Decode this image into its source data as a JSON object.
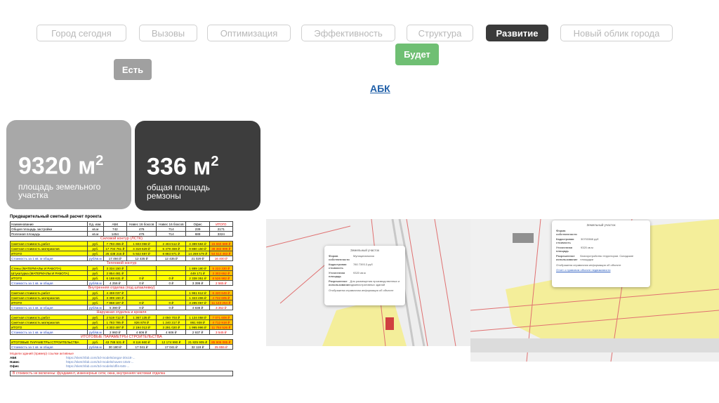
{
  "nav": [
    {
      "label": "Город сегодня"
    },
    {
      "label": "Вызовы"
    },
    {
      "label": "Оптимизация"
    },
    {
      "label": "Эффективность"
    },
    {
      "label": "Структура"
    },
    {
      "label": "Развитие",
      "active": true
    },
    {
      "label": "Новый облик города"
    }
  ],
  "tags": {
    "future": "Будет",
    "present": "Есть"
  },
  "link": "АБК",
  "cards": [
    {
      "value": "9320 м",
      "sup": "2",
      "label": "площадь земельного участка"
    },
    {
      "value": "336 м",
      "sup": "2",
      "label": "общая площадь ремзоны"
    }
  ],
  "sheet": {
    "title": "Предварительный сметный расчет проекта",
    "header": [
      "Наименование",
      "Ед. изм.",
      "АБК",
      "Навес 16 боксов",
      "Навес 16 боксов",
      "Офис",
      "ИТОГО"
    ],
    "rows": [
      {
        "c": [
          "Общая площадь застройки",
          "кв.м",
          "742",
          "476",
          "714",
          "239",
          "2171"
        ]
      },
      {
        "c": [
          "Полезная площадь",
          "кв.м",
          "1454",
          "476",
          "714",
          "688",
          "3324"
        ]
      },
      {
        "sec": "Силовой контур (ЛСТК)"
      },
      {
        "t": "y",
        "c": [
          "Сметная стоимость работ",
          "руб.",
          "7 793 455 ₽",
          "1 603 068 ₽",
          "2 404 512 ₽",
          "4 389 584 ₽",
          "15 660 589 ₽"
        ]
      },
      {
        "t": "y",
        "c": [
          "Сметная стоимость материалов",
          "руб.",
          "17 704 761 ₽",
          "4 319 629 ₽",
          "6 479 459 ₽",
          "9 880 150 ₽",
          "38 383 999 ₽"
        ]
      },
      {
        "t": "y",
        "c": [
          "ИТОГО",
          "руб.",
          "25 438 216 ₽",
          "5 922 697 ₽",
          "8 883 971 ₽",
          "14 269 579 ₽",
          "54 514 463 ₽"
        ]
      },
      {
        "t": "blue",
        "c": [
          "Стоимость за 1 кв. м общая",
          "руб/кв.м",
          "17 494 ₽",
          "12 435 ₽",
          "12 435 ₽",
          "21 029 ₽",
          "16 400 ₽"
        ]
      },
      {
        "sec": "Тепловой контур"
      },
      {
        "t": "y",
        "c": [
          "Стены (МАТЕРИАЛЫ И РАБОТА)",
          "руб.",
          "3 334 150 ₽",
          "",
          "",
          "1 889 180 ₽",
          "5 223 330 ₽"
        ]
      },
      {
        "t": "y",
        "c": [
          "Штукатурка (МАТЕРИАЛЫ И РАБОТА)",
          "руб.",
          "2 854 481 ₽",
          "",
          "",
          "449 171 ₽",
          "3 303 652 ₽"
        ]
      },
      {
        "t": "y",
        "c": [
          "ИТОГО",
          "руб.",
          "6 188 631 ₽",
          "0 ₽",
          "0 ₽",
          "2 338 351 ₽",
          "8 526 982 ₽"
        ]
      },
      {
        "t": "blue",
        "c": [
          "Стоимость за 1 кв. м общая",
          "руб/кв.м",
          "4 256 ₽",
          "0 ₽",
          "0 ₽",
          "3 399 ₽",
          "2 565 ₽"
        ]
      },
      {
        "sec": "Внутренняя отделка (под шпаклевку)"
      },
      {
        "t": "y",
        "c": [
          "Сметная стоимость работ",
          "руб.",
          "4 459 037 ₽",
          "",
          "",
          "1 961 612 ₽",
          "6 420 649 ₽"
        ]
      },
      {
        "t": "y",
        "c": [
          "Сметная стоимость материалов",
          "руб.",
          "3 399 150 ₽",
          "",
          "",
          "1 323 455 ₽",
          "4 722 605 ₽"
        ]
      },
      {
        "t": "y",
        "c": [
          "ИТОГО",
          "руб.",
          "7 858 187 ₽",
          "0 ₽",
          "0 ₽",
          "3 285 067 ₽",
          "11 143 254 ₽"
        ]
      },
      {
        "t": "blue",
        "c": [
          "Стоимость за 1 кв. м общая",
          "руб/кв.м",
          "5 390 ₽",
          "0 ₽",
          "0 ₽",
          "4 838 ₽",
          "3 352 ₽"
        ]
      },
      {
        "sec": "Наружная отделка и кровля"
      },
      {
        "t": "y",
        "c": [
          "Сметная стоимость работ",
          "руб.",
          "2 519 712 ₽",
          "1 367 135 ₽",
          "2 050 703 ₽",
          "1 134 058 ₽",
          "7 071 608 ₽"
        ]
      },
      {
        "t": "y",
        "c": [
          "Сметная стоимость материалов",
          "руб.",
          "1 783 785 ₽",
          "826 878 ₽",
          "1 240 317 ₽",
          "861 938 ₽",
          "4 712 918 ₽"
        ]
      },
      {
        "t": "y",
        "c": [
          "ИТОГО",
          "руб.",
          "4 303 497 ₽",
          "2 194 013 ₽",
          "3 291 020 ₽",
          "1 995 996 ₽",
          "11 784 526 ₽"
        ]
      },
      {
        "t": "blue",
        "c": [
          "Стоимость за 1 кв. м общая",
          "руб/кв.м",
          "2 960 ₽",
          "4 606 ₽",
          "4 606 ₽",
          "2 937 ₽",
          "3 545 ₽"
        ]
      },
      {
        "sec": "ИТОГОВЫЕ ПАРАМЕТРЫ СТРОИТЕЛЬСТВА"
      },
      {
        "t": "y",
        "c": [
          "ИТОГОВЫЕ ПАРАМЕТРЫ СТРОИТЕЛЬСТВА",
          "руб.",
          "43 788 531 ₽",
          "8 116 660 ₽",
          "12 174 990 ₽",
          "21 825 905 ₽",
          "85 906 085 ₽"
        ]
      },
      {
        "t": "blue",
        "c": [
          "Стоимость за 1 кв. м общая",
          "руб/кв.м",
          "30 180 ₽",
          "17 041 ₽",
          "17 041 ₽",
          "32 119 ₽",
          "25 855 ₽"
        ]
      }
    ],
    "links_title": "Модели зданий (пример) ссылки активные",
    "links": [
      {
        "k": "АБК",
        "v": "https://sketchfab.com/3d-models/angar-30x18-..."
      },
      {
        "k": "Навес",
        "v": "https://sketchfab.com/3d-models/naves-10x5-..."
      },
      {
        "k": "Офис",
        "v": "https://sketchfab.com/3d-models/offis-646-..."
      }
    ],
    "note": "В стоимость не включены: фундамент, инженерные сети, окна, внутренняя чистовая отделка"
  },
  "maps": [
    {
      "popup_title": "Земельный участок",
      "rows": [
        [
          "Форма собственности",
          "Муниципальная"
        ],
        [
          "Кадастровая стоимость",
          "780 7393.3 руб"
        ],
        [
          "Уточненная площадь",
          "9320 кв.м"
        ],
        [
          "Разрешенное использование",
          "Для размещения производственных и административных зданий"
        ]
      ],
      "footer": "Отображена справочная информация об объекте"
    },
    {
      "popup_title": "Земельный участок",
      "rows": [
        [
          "Форма собственности",
          ""
        ],
        [
          "Кадастровая стоимость",
          "30703388 руб"
        ],
        [
          "Уточненная площадь",
          "9320 кв.м"
        ],
        [
          "Разрешенное использование",
          "Благоустройство территории. Складские площадки"
        ]
      ],
      "footer": "Отображена справочная информация об объекте",
      "link": "Отчет о правовом объекте недвижимости"
    }
  ],
  "colors": {
    "active": "#3a3a3a",
    "future": "#6fbf73",
    "present": "#a0a0a0",
    "card1": "#a8a8a8",
    "card2": "#3d3d3d",
    "link": "#1f5fa8"
  }
}
